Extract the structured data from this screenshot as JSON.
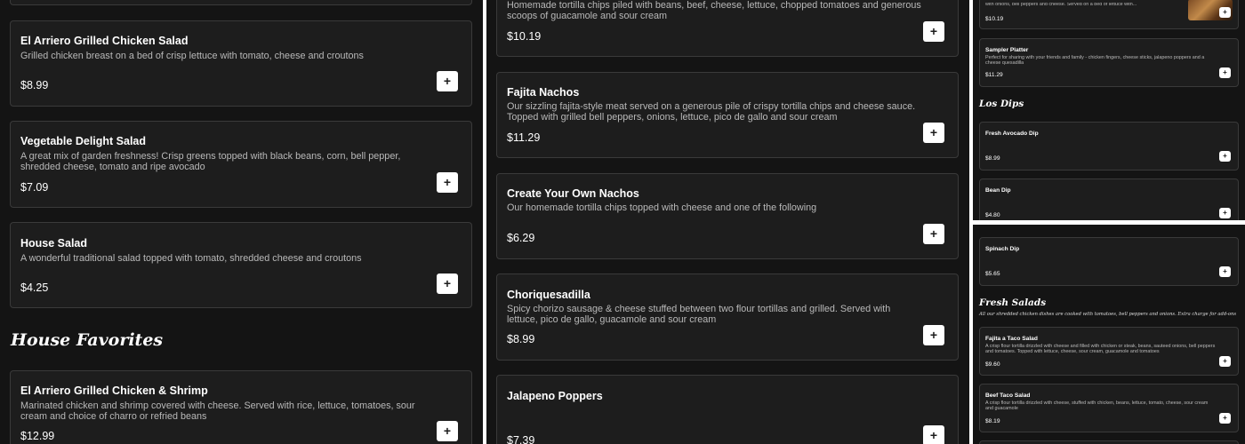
{
  "panel1": {
    "top_card_stub": "",
    "items": [
      {
        "title": "El Arriero Grilled Chicken Salad",
        "desc": "Grilled chicken breast on a bed of crisp lettuce with tomato, cheese and croutons",
        "price": "$8.99"
      },
      {
        "title": "Vegetable Delight Salad",
        "desc": "A great mix of garden freshness! Crisp greens topped with black beans, corn, bell pepper, shredded cheese, tomato and ripe avocado",
        "price": "$7.09"
      },
      {
        "title": "House Salad",
        "desc": "A wonderful traditional salad topped with tomato, shredded cheese and croutons",
        "price": "$4.25"
      },
      {
        "title": "El Arriero Grilled Chicken & Shrimp",
        "desc": "Marinated chicken and shrimp covered with cheese. Served with rice, lettuce, tomatoes, sour cream and choice of charro or refried beans",
        "price": "$12.99"
      }
    ],
    "section_title": "House Favorites"
  },
  "panel2": {
    "items": [
      {
        "title": "",
        "desc": "Homemade tortilla chips piled with beans, beef, cheese, lettuce, chopped tomatoes and generous scoops of guacamole and sour cream",
        "price": "$10.19"
      },
      {
        "title": "Fajita Nachos",
        "desc": "Our sizzling fajita-style meat served on a generous pile of crispy tortilla chips and cheese sauce. Topped with grilled bell peppers, onions, lettuce, pico de gallo and sour cream",
        "price": "$11.29"
      },
      {
        "title": "Create Your Own Nachos",
        "desc": "Our homemade tortilla chips topped with cheese and one of the following",
        "price": "$6.29"
      },
      {
        "title": "Choriquesadilla",
        "desc": "Spicy chorizo sausage & cheese stuffed between two flour tortillas and grilled. Served with lettuce, pico de gallo, guacamole and sour cream",
        "price": "$8.99"
      },
      {
        "title": "Jalapeno Poppers",
        "desc": "",
        "price": "$7.39"
      }
    ]
  },
  "panel3a": {
    "top_card": {
      "desc": "with onions, bell peppers and cheese. Served on a bed of lettuce with...",
      "price": "$10.19"
    },
    "items": [
      {
        "title": "Sampler Platter",
        "desc": "Perfect for sharing with your friends and family - chicken fingers, cheese sticks, jalapeno poppers and a cheese quesadilla",
        "price": "$11.29"
      }
    ],
    "section_title": "Los Dips",
    "dips": [
      {
        "title": "Fresh Avocado Dip",
        "price": "$8.99"
      },
      {
        "title": "Bean Dip",
        "price": "$4.80"
      }
    ]
  },
  "panel3b": {
    "dips": [
      {
        "title": "Spinach Dip",
        "price": "$5.65"
      }
    ],
    "section_title": "Fresh Salads",
    "section_note": "All our shredded chicken dishes are cooked with tomatoes, bell peppers and onions. Extra charge for add-ons",
    "items": [
      {
        "title": "Fajita a Taco Salad",
        "desc": "A crisp flour tortilla drizzled with cheese and filled with chicken or steak, beans, sauteed onions, bell peppers and tomatoes. Topped with lettuce, cheese, sour cream, guacamole and tomatoes",
        "price": "$9.60"
      },
      {
        "title": "Beef Taco Salad",
        "desc": "A crisp flour tortilla drizzled with cheese, stuffed with chicken, beans, lettuce, tomato, cheese, sour cream and guacamole",
        "price": "$8.19"
      }
    ]
  },
  "add_icon": "plus-icon",
  "colors": {
    "background": "#141414",
    "card": "#1d1d1d",
    "border": "#3a3a3a",
    "button": "#ffffff"
  }
}
